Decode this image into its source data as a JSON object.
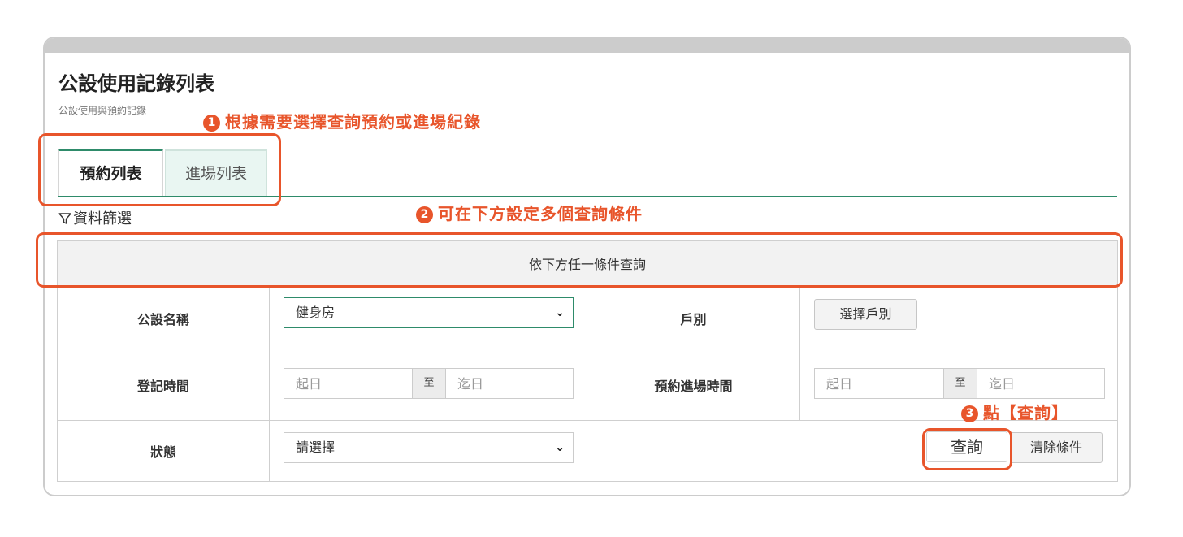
{
  "header": {
    "title": "公設使用記錄列表",
    "subtitle": "公設使用與預約記錄"
  },
  "annotations": {
    "step1": {
      "num": "1",
      "text": "根據需要選擇查詢預約或進場紀錄"
    },
    "step2": {
      "num": "2",
      "text": "可在下方設定多個查詢條件"
    },
    "step3": {
      "num": "3",
      "text": "點【查詢】"
    }
  },
  "tabs": [
    {
      "label": "預約列表",
      "active": true
    },
    {
      "label": "進場列表",
      "active": false
    }
  ],
  "filter": {
    "title": "資料篩選",
    "icon": "filter-icon",
    "table_header": "依下方任一條件查詢",
    "facility": {
      "label": "公設名稱",
      "value": "健身房"
    },
    "household": {
      "label": "戶別",
      "button": "選擇戶別"
    },
    "register_time": {
      "label": "登記時間",
      "from_placeholder": "起日",
      "sep": "至",
      "to_placeholder": "迄日"
    },
    "booking_time": {
      "label": "預約進場時間",
      "from_placeholder": "起日",
      "sep": "至",
      "to_placeholder": "迄日"
    },
    "status": {
      "label": "狀態",
      "value": "請選擇"
    },
    "search_button": "查詢",
    "clear_button": "清除條件"
  },
  "colors": {
    "accent": "#2e8b6a",
    "annotation": "#e8552b",
    "tab_inactive_bg": "#e9f6f2"
  }
}
